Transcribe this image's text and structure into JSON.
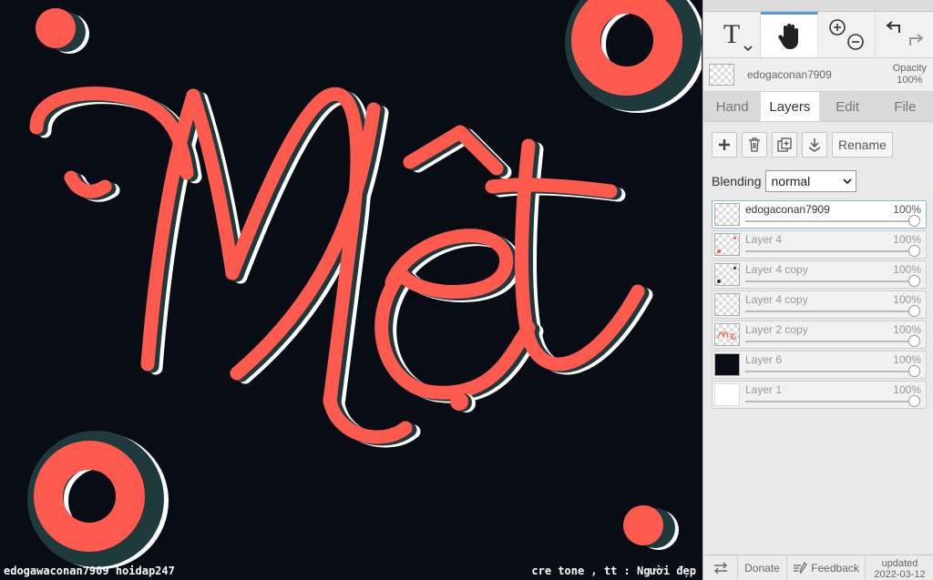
{
  "canvas": {
    "caption_left": "edogawaconan7909 hoidap247",
    "caption_right": "cre tone , tt : Người đẹp",
    "background": "#080c14",
    "accent": "#ff5a4e",
    "shadow_dark": "#1f3a3d",
    "shadow_light": "#ffffff"
  },
  "toolbar": {
    "tools": [
      {
        "label": "T",
        "icon": "text-tool-icon"
      },
      {
        "label": "",
        "icon": "hand-tool-icon",
        "active": true
      },
      {
        "label": "",
        "icon": "zoom-icon"
      },
      {
        "label": "",
        "icon": "undo-redo-icon"
      }
    ]
  },
  "layer_info": {
    "name": "edogaconan7909",
    "opacity_label": "Opacity",
    "opacity_value": "100%"
  },
  "tabs": [
    "Hand",
    "Layers",
    "Edit",
    "File"
  ],
  "active_tab": "Layers",
  "actions": {
    "rename_label": "Rename",
    "icons": [
      "add-layer-icon",
      "delete-layer-icon",
      "duplicate-layer-icon",
      "merge-down-icon"
    ]
  },
  "blending": {
    "label": "Blending",
    "value": "normal"
  },
  "layers": [
    {
      "name": "edogaconan7909",
      "opacity": "100%",
      "selected": true,
      "thumb": "checker"
    },
    {
      "name": "Layer 4",
      "opacity": "100%",
      "thumb": "checker-dots"
    },
    {
      "name": "Layer 4 copy",
      "opacity": "100%",
      "thumb": "checker-dots"
    },
    {
      "name": "Layer 4 copy",
      "opacity": "100%",
      "thumb": "checker"
    },
    {
      "name": "Layer 2 copy",
      "opacity": "100%",
      "thumb": "text"
    },
    {
      "name": "Layer 6",
      "opacity": "100%",
      "thumb": "dark"
    },
    {
      "name": "Layer 1",
      "opacity": "100%",
      "thumb": "white"
    }
  ],
  "footer": {
    "donate": "Donate",
    "feedback": "Feedback",
    "updated": "updated",
    "date": "2022-03-12"
  }
}
